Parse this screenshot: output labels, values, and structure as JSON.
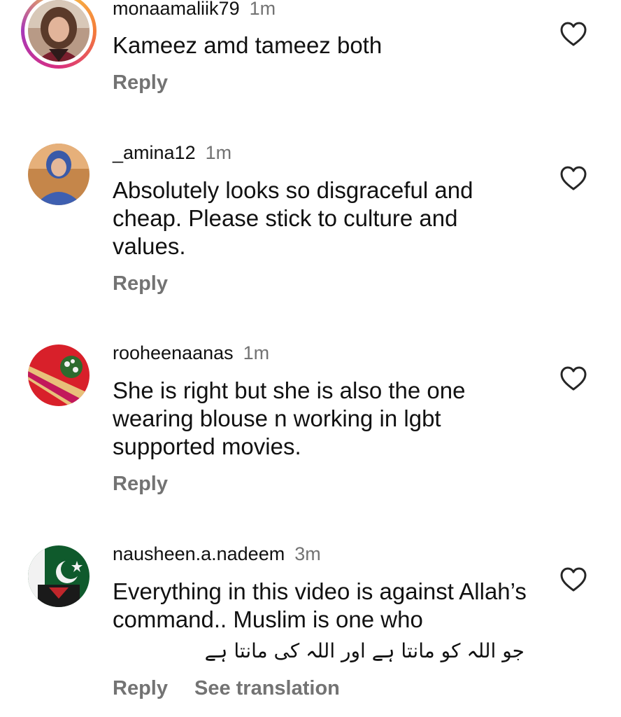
{
  "comments": [
    {
      "username": "monaamaliik79",
      "time": "1m",
      "text": "Kameez amd tameez both",
      "reply": "Reply",
      "avatar_icon": "profile-photo-with-story-ring"
    },
    {
      "username": "_amina12",
      "time": "1m",
      "text": "Absolutely looks so disgraceful and cheap. Please stick to culture and values.",
      "reply": "Reply",
      "avatar_icon": "profile-photo"
    },
    {
      "username": "rooheenaanas",
      "time": "1m",
      "text": "She is right but she is also the one wearing blouse n working in lgbt supported movies.",
      "reply": "Reply",
      "avatar_icon": "profile-photo"
    },
    {
      "username": "nausheen.a.nadeem",
      "time": "3m",
      "text": "Everything in this video is against Allah’s command.. Muslim is one who",
      "text_urdu": "جو اللہ کو مانتا ہے اور اللہ کی مانتا ہے",
      "reply": "Reply",
      "see_translation": "See translation",
      "avatar_icon": "profile-photo"
    }
  ],
  "colors": {
    "text": "#111111",
    "secondary": "#737373",
    "heart_outline": "#262626"
  },
  "icons": {
    "like": "heart-outline-icon"
  }
}
